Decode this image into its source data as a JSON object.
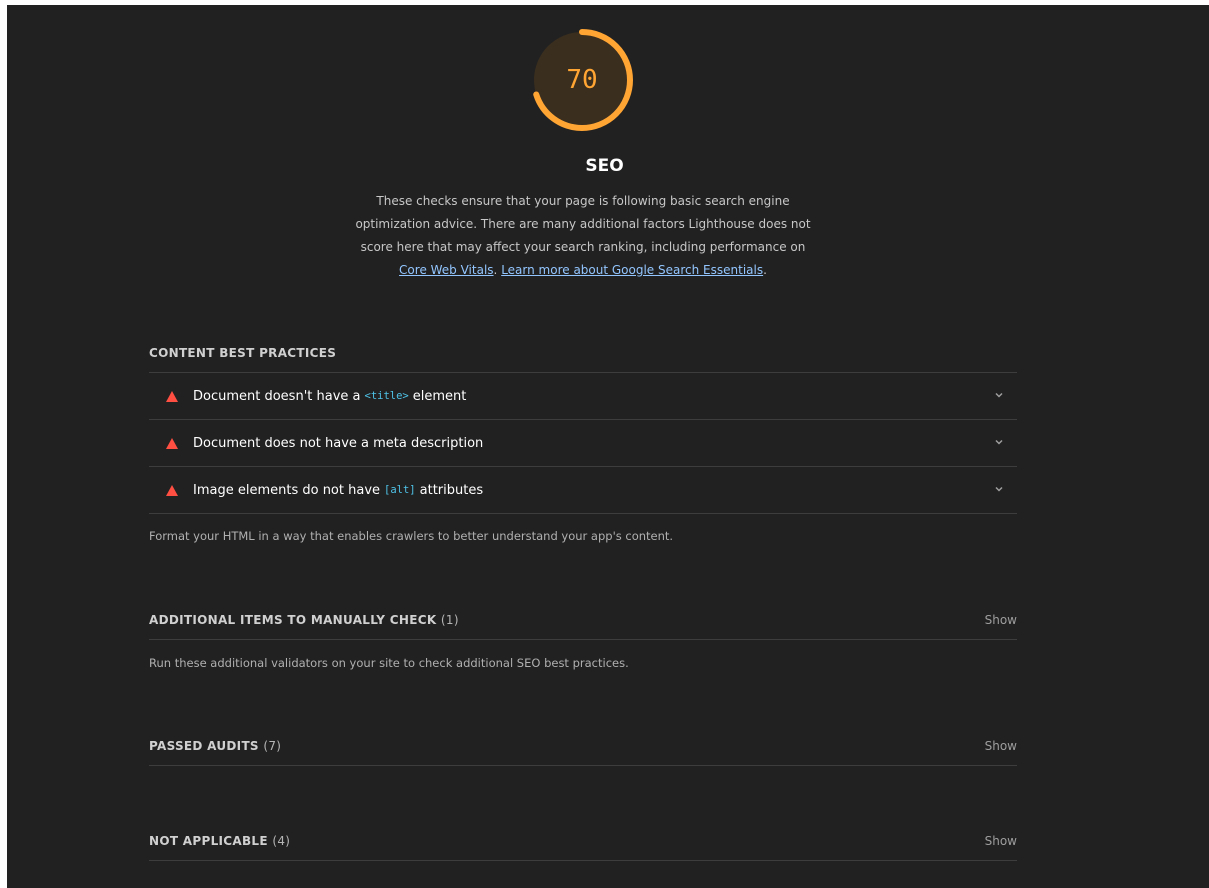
{
  "score": {
    "value": "70",
    "fraction": 0.7,
    "color": "#ffa534"
  },
  "category": {
    "title": "SEO",
    "desc_line1": "These checks ensure that your page is following basic search engine",
    "desc_line2": "optimization advice. There are many additional factors Lighthouse does not",
    "desc_line3": "score here that may affect your search ranking, including performance on",
    "link1": "Core Web Vitals",
    "sep": ". ",
    "link2": "Learn more about Google Search Essentials",
    "end": "."
  },
  "content_group": {
    "title": "CONTENT BEST PRACTICES",
    "audits": [
      {
        "before": "Document doesn't have a ",
        "code": "<title>",
        "after": " element"
      },
      {
        "before": "Document does not have a meta description",
        "code": "",
        "after": ""
      },
      {
        "before": "Image elements do not have ",
        "code": "[alt]",
        "after": " attributes"
      }
    ],
    "note": "Format your HTML in a way that enables crawlers to better understand your app's content."
  },
  "manual_group": {
    "title": "ADDITIONAL ITEMS TO MANUALLY CHECK",
    "count": "(1)",
    "show": "Show",
    "note": "Run these additional validators on your site to check additional SEO best practices."
  },
  "passed_group": {
    "title": "PASSED AUDITS",
    "count": "(7)",
    "show": "Show"
  },
  "na_group": {
    "title": "NOT APPLICABLE",
    "count": "(4)",
    "show": "Show"
  },
  "icons": {
    "fail": "fail-triangle-icon",
    "expand": "chevron-down-icon"
  },
  "colors": {
    "fail": "#ff4e42",
    "average": "#ffa534",
    "link": "#93c6ff",
    "code": "#4fc3e8"
  }
}
